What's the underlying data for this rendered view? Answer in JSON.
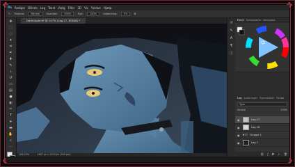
{
  "menu": {
    "app_icon": "Ps",
    "items": [
      "Rediger",
      "Billede",
      "Lag",
      "Tekst",
      "Vælg",
      "Filter",
      "3D",
      "Vis",
      "Vindue",
      "Hjælp"
    ]
  },
  "options": {
    "mode_label": "Tilstand:",
    "mode_value": "Normal",
    "opacity_label": "Opacitet:",
    "opacity_value": "100%",
    "flow_label": "Tryk:",
    "flow_value": "100%",
    "smoothing_label": "Udjævning:",
    "smoothing_value": "0%"
  },
  "document": {
    "tab_title": "DarkLiquid.tif @ 147% (Lag 17, RGB/8) *"
  },
  "status": {
    "zoom": "146,53%",
    "size": "1487 px x 2074 px (300 ppi)"
  },
  "panels": {
    "color_tabs": [
      "Farve",
      "Farveprøver",
      "Navigator"
    ],
    "layer_tabs": [
      "Lag",
      "Justeringer",
      "Egenskaber",
      "Forløb"
    ],
    "search_placeholder": "Type",
    "blend_mode": "Normal",
    "opacity_short": "100%",
    "layers": [
      {
        "name": "Lag 17",
        "selected": true
      },
      {
        "name": "Lag 16",
        "selected": false
      },
      {
        "name": "Gruppe 1",
        "selected": false
      },
      {
        "name": "Lag 7",
        "selected": false
      }
    ]
  },
  "colors": {
    "frame": "#8b2c3c",
    "accent": "#b03a4e",
    "skin": "#5b86a6",
    "hair": "#14161c",
    "eye": "#e8c77a"
  }
}
